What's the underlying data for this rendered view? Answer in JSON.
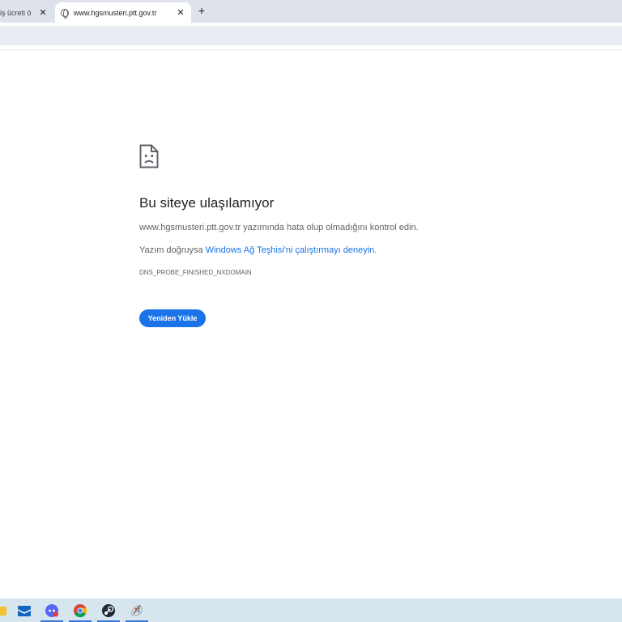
{
  "browser": {
    "tabs": [
      {
        "title": "iş ücreti ö",
        "active": false
      },
      {
        "title": "www.hgsmusteri.ptt.gov.tr",
        "active": true
      }
    ],
    "close_glyph": "✕",
    "new_tab_glyph": "+"
  },
  "error_page": {
    "icon": "sad-document-icon",
    "heading": "Bu siteye ulaşılamıyor",
    "check_text": "www.hgsmusteri.ptt.gov.tr yazımında hata olup olmadığını kontrol edin.",
    "suggestion_prefix": "Yazım doğruysa ",
    "suggestion_link": "Windows Ağ Teşhisi'ni çalıştırmayı deneyin",
    "suggestion_suffix": ".",
    "error_code": "DNS_PROBE_FINISHED_NXDOMAIN",
    "reload_label": "Yeniden Yükle"
  },
  "taskbar": {
    "items": [
      {
        "icon": "folder-icon",
        "active": false
      },
      {
        "icon": "mail-icon",
        "active": false
      },
      {
        "icon": "discord-icon",
        "active": true
      },
      {
        "icon": "chrome-icon",
        "active": true
      },
      {
        "icon": "steam-icon",
        "active": true
      },
      {
        "icon": "paint-icon",
        "active": true
      }
    ]
  },
  "colors": {
    "accent": "#1a73e8",
    "tabstrip": "#dee3eb",
    "taskbar": "#d7e5ef"
  }
}
